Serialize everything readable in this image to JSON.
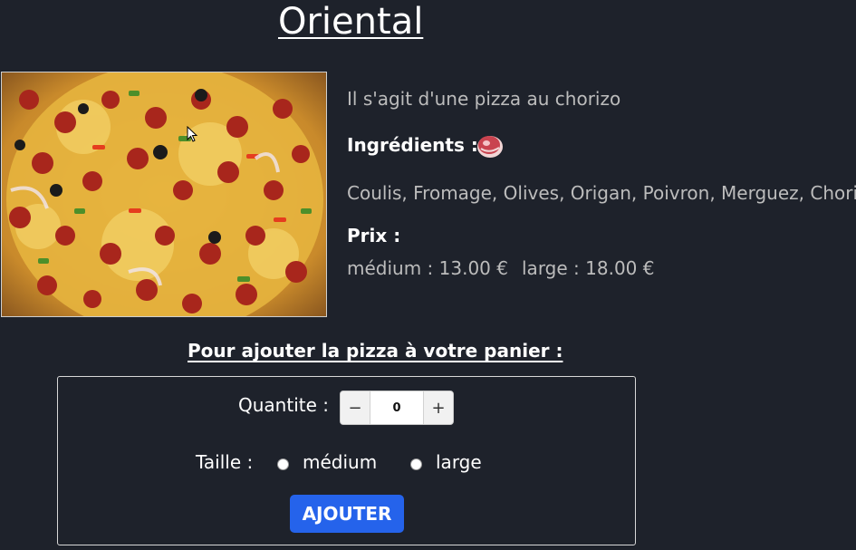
{
  "pizza": {
    "name": "Oriental",
    "description": "Il s'agit d'une pizza au chorizo",
    "ingredients_label": "Ingrédients :",
    "ingredients_icon": "meat-icon",
    "ingredients": "Coulis, Fromage, Olives, Origan, Poivron, Merguez, Chorizo",
    "price_label": "Prix :",
    "price_medium": "médium : 13.00 €",
    "price_large": "large : 18.00 €"
  },
  "cart": {
    "heading": "Pour ajouter la pizza à votre panier :",
    "quantity_label": "Quantite :",
    "quantity_value": "0",
    "minus": "−",
    "plus": "+",
    "size_label": "Taille :",
    "size_options": [
      "médium",
      "large"
    ],
    "add_button": "AJOUTER"
  },
  "colors": {
    "background": "#1e222b",
    "accent": "#2563eb",
    "muted_text": "#bcbcbc"
  }
}
